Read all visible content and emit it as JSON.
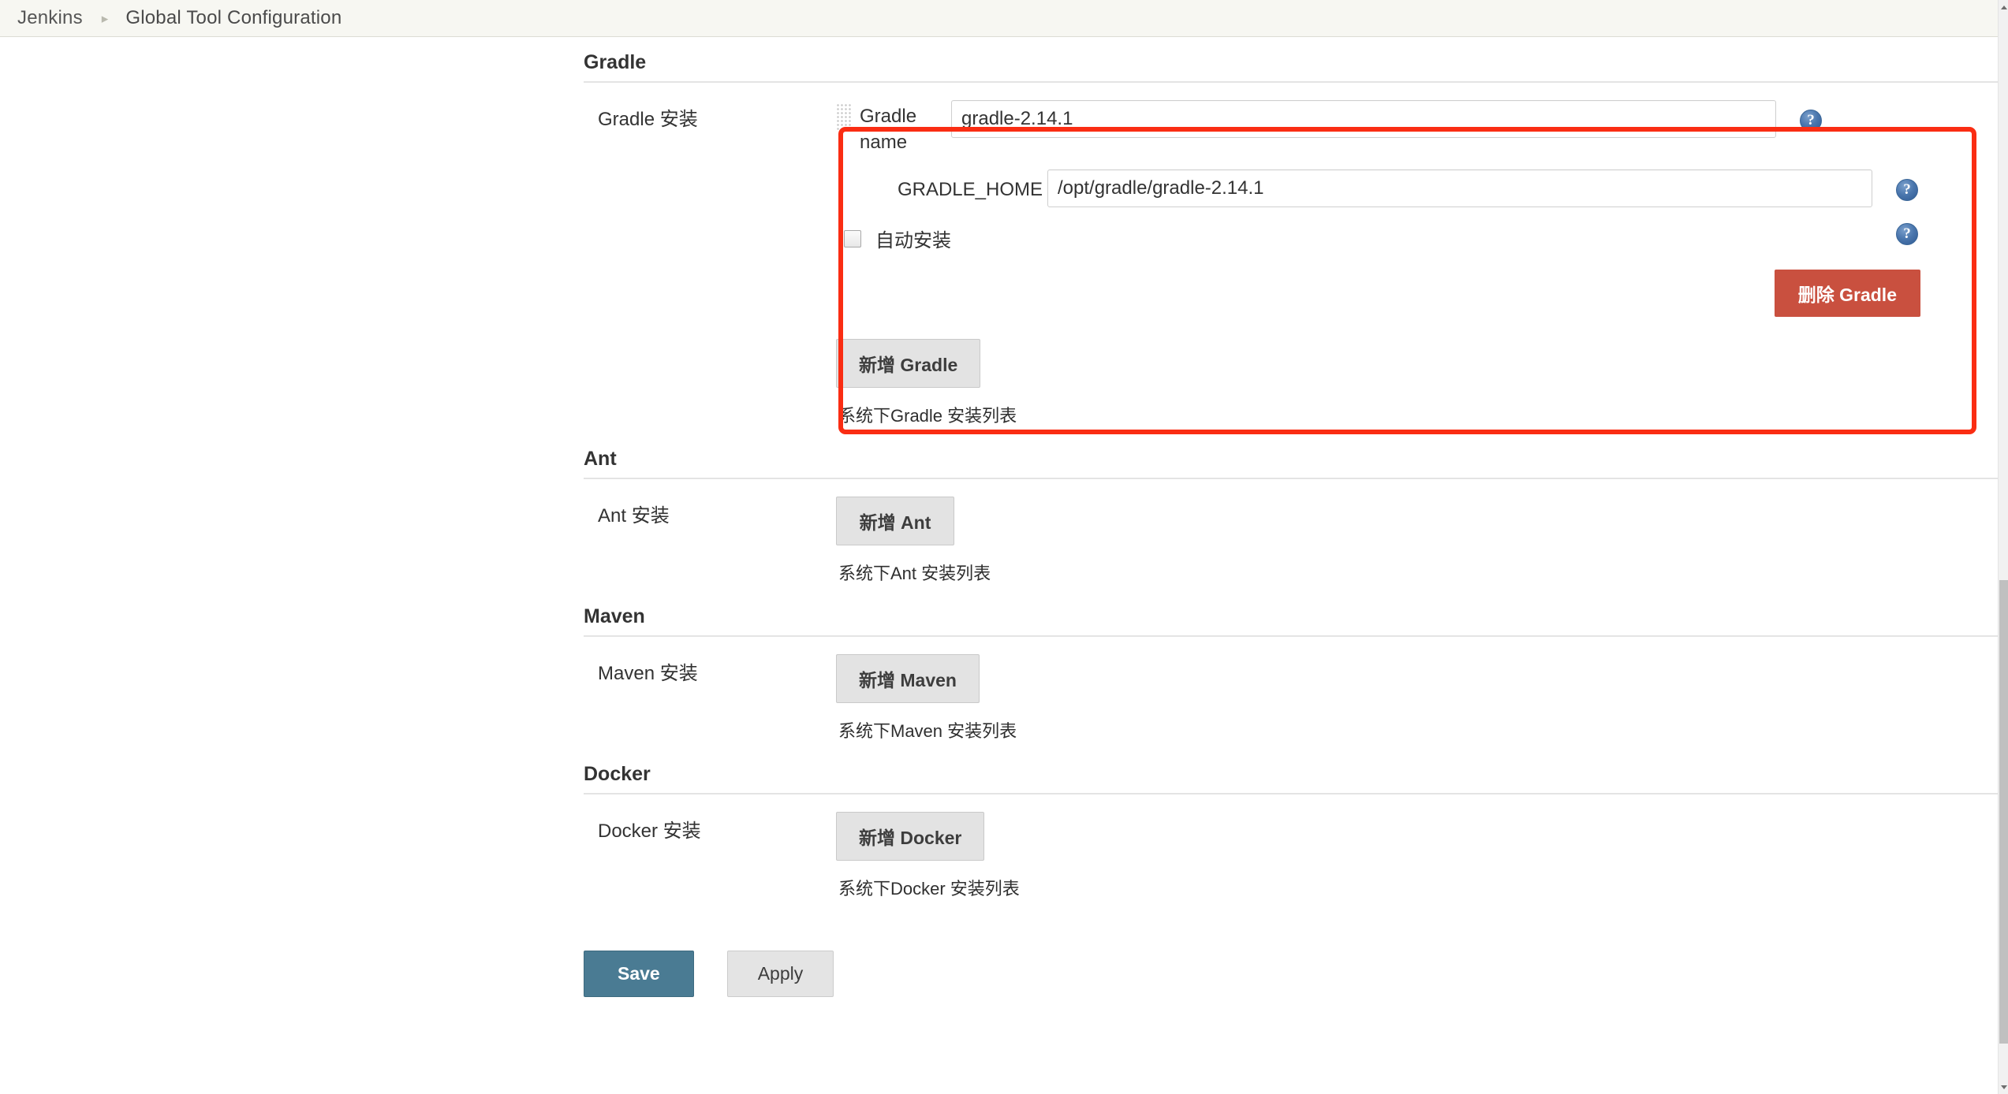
{
  "breadcrumb": {
    "root": "Jenkins",
    "separator": "▸",
    "current": "Global Tool Configuration"
  },
  "sections": {
    "gradle": {
      "title": "Gradle",
      "row_label": "Gradle 安装",
      "installation": {
        "name_label": "Gradle name",
        "name_value": "gradle-2.14.1",
        "home_label": "GRADLE_HOME",
        "home_value": "/opt/gradle/gradle-2.14.1",
        "auto_install_label": "自动安装",
        "auto_install_checked": false,
        "delete_label": "删除 Gradle",
        "drag_handle_icon": "drag-dots-icon",
        "help_icon": "help-question-icon"
      },
      "add_label": "新增 Gradle",
      "hint": "系统下Gradle 安装列表"
    },
    "ant": {
      "title": "Ant",
      "row_label": "Ant 安装",
      "add_label": "新增 Ant",
      "hint": "系统下Ant 安装列表"
    },
    "maven": {
      "title": "Maven",
      "row_label": "Maven 安装",
      "add_label": "新增 Maven",
      "hint": "系统下Maven 安装列表"
    },
    "docker": {
      "title": "Docker",
      "row_label": "Docker 安装",
      "add_label": "新增 Docker",
      "hint": "系统下Docker 安装列表"
    }
  },
  "footer": {
    "save_label": "Save",
    "apply_label": "Apply"
  },
  "colors": {
    "danger": "#c9503f",
    "save": "#4a7b93",
    "highlight": "#fa2d13",
    "help": "#4a76ad",
    "breadcrumb_bg": "#f7f7f2"
  },
  "annotation": {
    "highlight_shape": "rounded-rectangle",
    "highlight_target": "gradle-installation-block"
  },
  "help_icon_glyph": "?"
}
